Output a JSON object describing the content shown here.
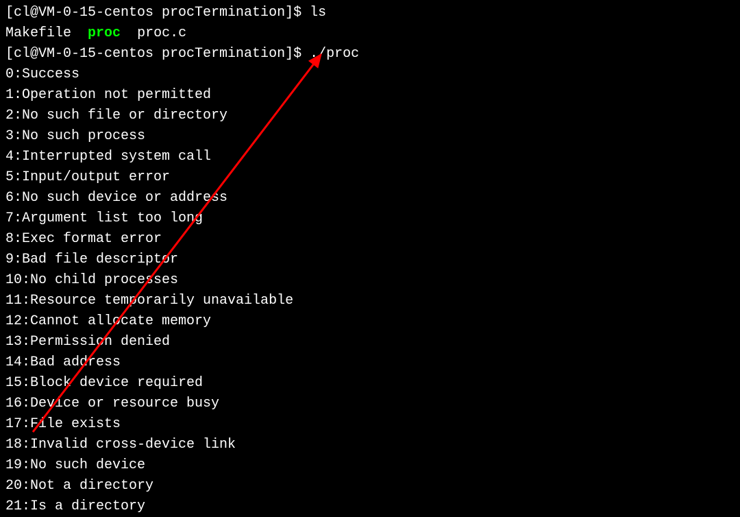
{
  "prompt1": {
    "prefix": "[cl@VM-0-15-centos procTermination]$ ",
    "command": "ls"
  },
  "ls_output": {
    "file1": "Makefile",
    "sep1": "  ",
    "file2": "proc",
    "sep2": "  ",
    "file3": "proc.c"
  },
  "prompt2": {
    "prefix": "[cl@VM-0-15-centos procTermination]$ ",
    "command": "./proc"
  },
  "errors": [
    "0:Success",
    "1:Operation not permitted",
    "2:No such file or directory",
    "3:No such process",
    "4:Interrupted system call",
    "5:Input/output error",
    "6:No such device or address",
    "7:Argument list too long",
    "8:Exec format error",
    "9:Bad file descriptor",
    "10:No child processes",
    "11:Resource temporarily unavailable",
    "12:Cannot allocate memory",
    "13:Permission denied",
    "14:Bad address",
    "15:Block device required",
    "16:Device or resource busy",
    "17:File exists",
    "18:Invalid cross-device link",
    "19:No such device",
    "20:Not a directory",
    "21:Is a directory"
  ]
}
